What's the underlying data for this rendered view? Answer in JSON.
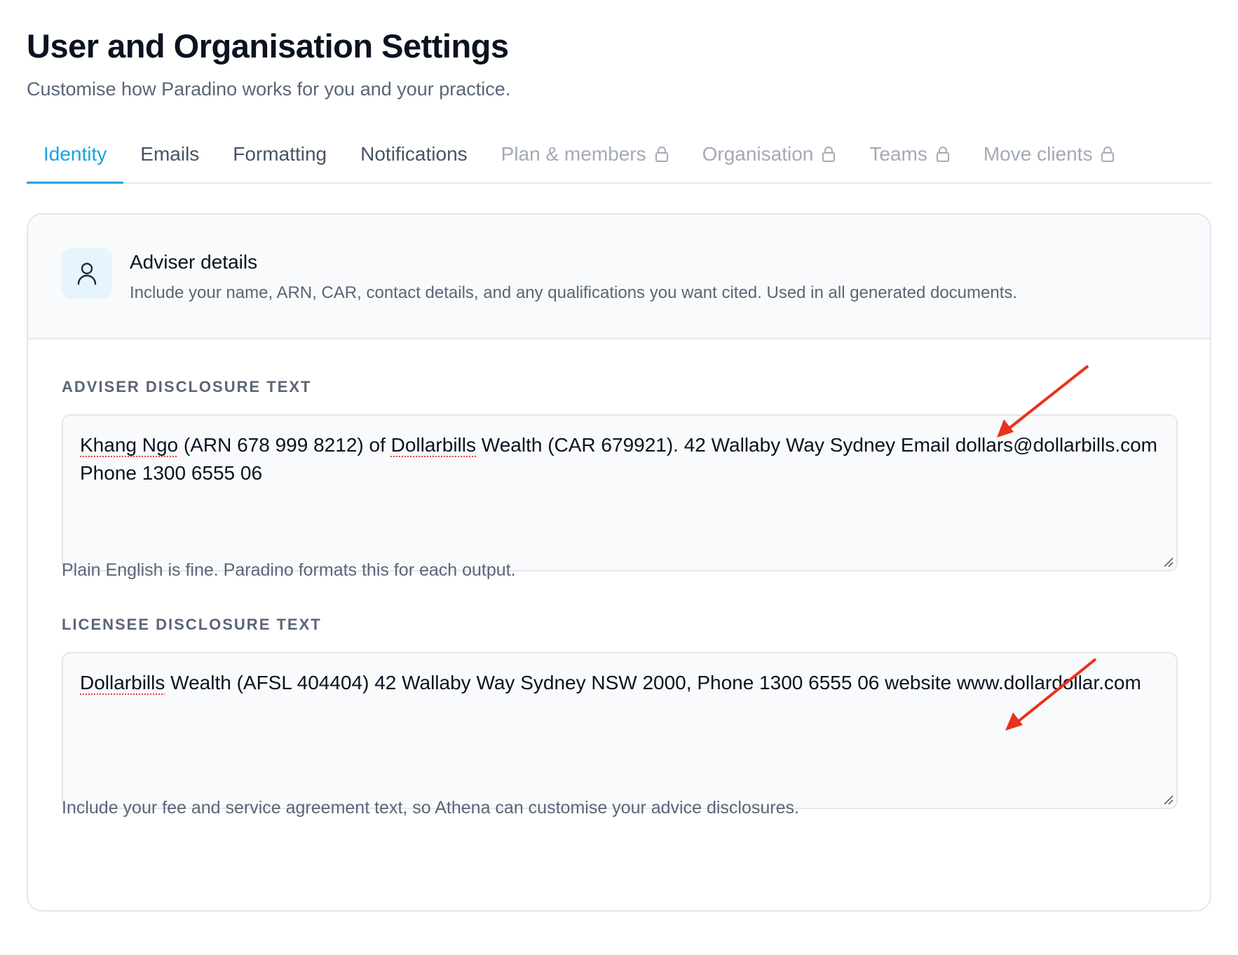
{
  "page": {
    "title": "User and Organisation Settings",
    "subtitle": "Customise how Paradino works for you and your practice."
  },
  "tabs": [
    {
      "label": "Identity",
      "state": "active"
    },
    {
      "label": "Emails",
      "state": "normal"
    },
    {
      "label": "Formatting",
      "state": "normal"
    },
    {
      "label": "Notifications",
      "state": "normal"
    },
    {
      "label": "Plan & members",
      "state": "locked",
      "icon": "lock-icon"
    },
    {
      "label": "Organisation",
      "state": "locked",
      "icon": "lock-icon"
    },
    {
      "label": "Teams",
      "state": "locked",
      "icon": "lock-icon"
    },
    {
      "label": "Move clients",
      "state": "locked",
      "icon": "lock-icon"
    }
  ],
  "card": {
    "icon": "user-icon",
    "title": "Adviser details",
    "description": "Include your name, ARN, CAR, contact details, and any qualifications you want cited. Used in all generated documents."
  },
  "adviser_disclosure": {
    "label": "ADVISER DISCLOSURE TEXT",
    "value_parts": [
      "Khang Ngo",
      " (ARN 678 999 8212) of ",
      "Dollarbills",
      " Wealth (CAR 679921). 42 Wallaby Way Sydney Email dollars@dollarbills.com Phone 1300 6555 06"
    ],
    "helper": "Plain English is fine. Paradino formats this for each output."
  },
  "licensee_disclosure": {
    "label": "LICENSEE DISCLOSURE TEXT",
    "value_parts": [
      "Dollarbills",
      " Wealth (AFSL 404404) 42 Wallaby Way Sydney NSW 2000, Phone 1300 6555 06 website www.dollardollar.com"
    ],
    "helper": "Include your fee and service agreement text, so Athena can customise your advice disclosures."
  },
  "colors": {
    "accent": "#1ba3e0",
    "annotation_arrow": "#e8321e"
  }
}
